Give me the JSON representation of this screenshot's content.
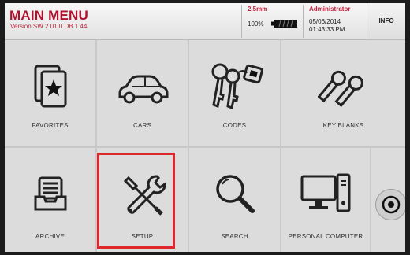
{
  "header": {
    "title": "MAIN MENU",
    "version": "Version SW 2.01.0 DB 1.44",
    "tool": "2.5mm",
    "battery": "100%",
    "user": "Administrator",
    "date": "05/06/2014",
    "time": "01:43:33 PM",
    "info": "INFO"
  },
  "tiles": {
    "favorites": "FAVORITES",
    "cars": "CARS",
    "codes": "CODES",
    "key_blanks": "KEY BLANKS",
    "archive": "ARCHIVE",
    "setup": "SETUP",
    "search": "SEARCH",
    "personal_computer": "PERSONAL COMPUTER"
  },
  "icons": {
    "favorites": "star-card-icon",
    "cars": "car-icon",
    "codes": "key-tag-icon",
    "key_blanks": "key-blanks-icon",
    "archive": "archive-tray-icon",
    "setup": "tools-icon",
    "search": "magnifier-icon",
    "personal_computer": "computer-icon",
    "power": "power-icon"
  },
  "colors": {
    "brand_red": "#b0122e",
    "highlight": "#e1262d",
    "tile_bg": "#dcdcdc"
  }
}
